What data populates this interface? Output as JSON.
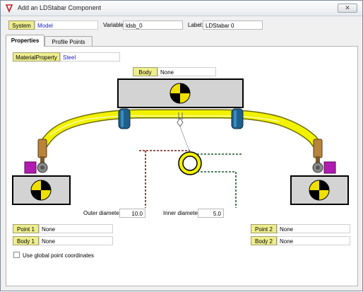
{
  "window": {
    "title": "Add an LDStabar Component",
    "close_label": "✕"
  },
  "toprow": {
    "system_label": "System",
    "system_value": "Model",
    "variable_label": "Variable:",
    "variable_value": "ldsb_0",
    "label_label": "Label:",
    "label_value": "LDStabar 0"
  },
  "tabs": [
    {
      "label": "Properties",
      "active": true
    },
    {
      "label": "Profile Points",
      "active": false
    }
  ],
  "properties": {
    "material_label": "MaterialProperty",
    "material_value": "Steel",
    "body_label": "Body",
    "body_value": "None",
    "outer_diameter_label": "Outer diameter:",
    "outer_diameter_value": "10.0",
    "inner_diameter_label": "Inner diameter:",
    "inner_diameter_value": "5.0",
    "point1_label": "Point 1",
    "point1_value": "None",
    "body1_label": "Body 1",
    "body1_value": "None",
    "point2_label": "Point 2",
    "point2_value": "None",
    "body2_label": "Body 2",
    "body2_value": "None",
    "global_coords_label": "Use global point coordinates",
    "global_coords_checked": false
  },
  "colors": {
    "button_yellow": "#eeee8e",
    "bar_yellow": "#f2f200",
    "bushing_blue": "#1f5f8a",
    "magenta": "#b01cb0",
    "link_blue": "#1d1dcc"
  }
}
